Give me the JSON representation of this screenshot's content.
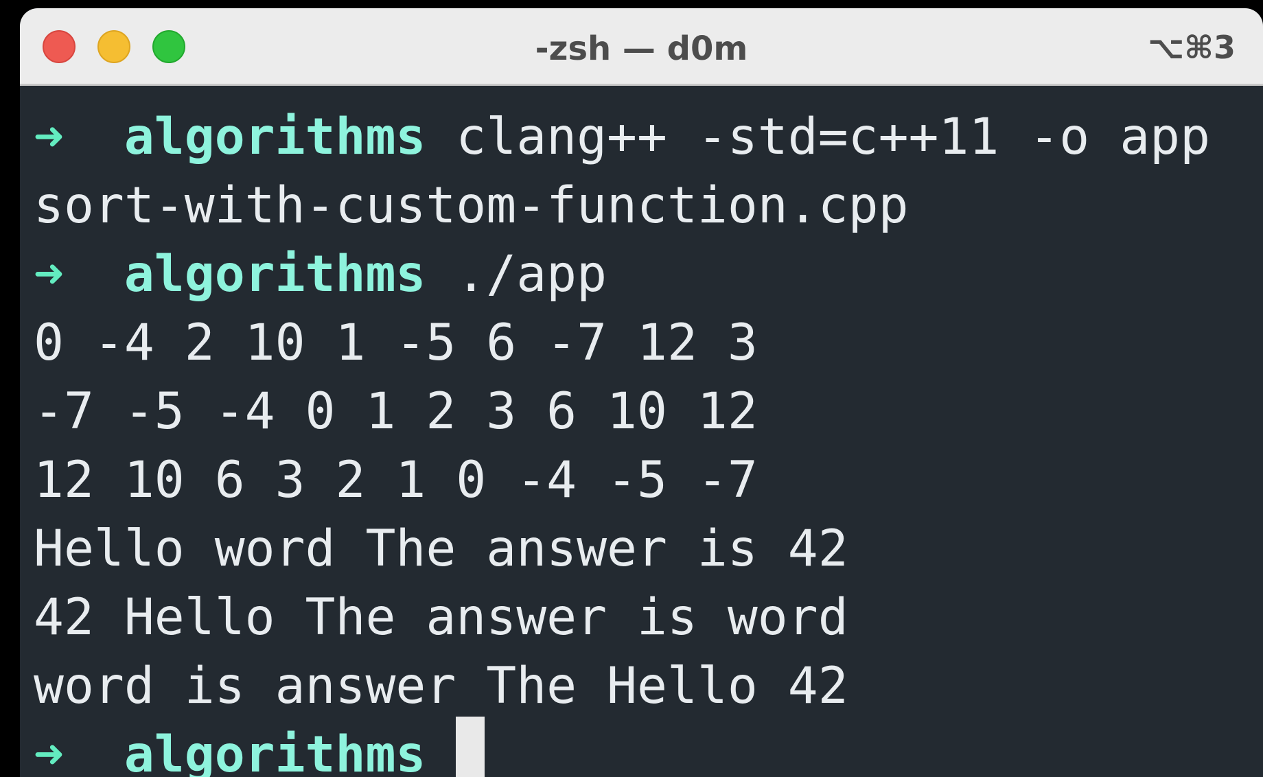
{
  "window": {
    "title": "-zsh — d0m",
    "shortcut": "⌥⌘3"
  },
  "terminal": {
    "prompt_arrow": "➜",
    "prompt_dir": "algorithms",
    "lines": [
      {
        "type": "prompt",
        "command": "clang++ -std=c++11 -o app"
      },
      {
        "type": "output",
        "text": "sort-with-custom-function.cpp"
      },
      {
        "type": "prompt",
        "command": "./app"
      },
      {
        "type": "output",
        "text": "0 -4 2 10 1 -5 6 -7 12 3"
      },
      {
        "type": "output",
        "text": "-7 -5 -4 0 1 2 3 6 10 12"
      },
      {
        "type": "output",
        "text": "12 10 6 3 2 1 0 -4 -5 -7"
      },
      {
        "type": "output",
        "text": "Hello word The answer is 42"
      },
      {
        "type": "output",
        "text": "42 Hello The answer is word"
      },
      {
        "type": "output",
        "text": "word is answer The Hello 42"
      },
      {
        "type": "prompt",
        "command": "",
        "cursor": true
      }
    ]
  },
  "colors": {
    "background": "#232a31",
    "prompt_arrow": "#63ecc0",
    "prompt_dir": "#8ef3dd",
    "text": "#e8ecef",
    "titlebar": "#ececec",
    "close": "#ee5a52",
    "minimize": "#f5be32",
    "zoom": "#30c53f"
  }
}
